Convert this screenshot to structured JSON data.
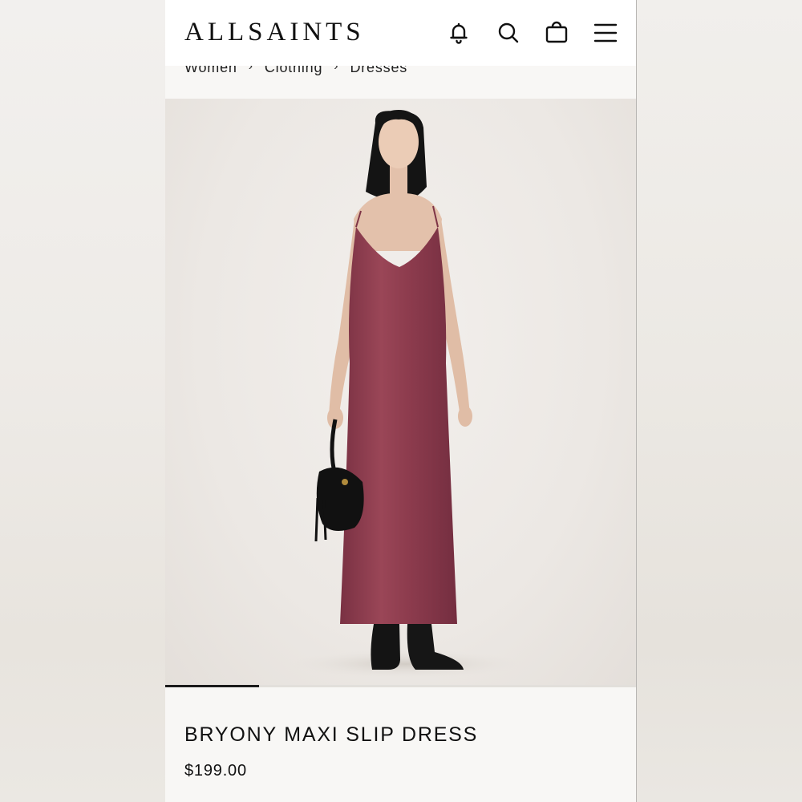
{
  "header": {
    "logo": "ALLSAINTS",
    "icons": [
      "bell-icon",
      "search-icon",
      "bag-icon",
      "menu-icon"
    ]
  },
  "breadcrumb": {
    "items": [
      "Women",
      "Clothing",
      "Dresses"
    ],
    "separator": "›"
  },
  "carousel": {
    "progress_fraction": 0.2
  },
  "product": {
    "name": "BRYONY MAXI SLIP DRESS",
    "price": "$199.00",
    "dress_color": "#8e3c4e"
  },
  "colors": {
    "page_bg": "#ece9e5",
    "panel_bg": "#f8f7f5",
    "text": "#111111"
  }
}
